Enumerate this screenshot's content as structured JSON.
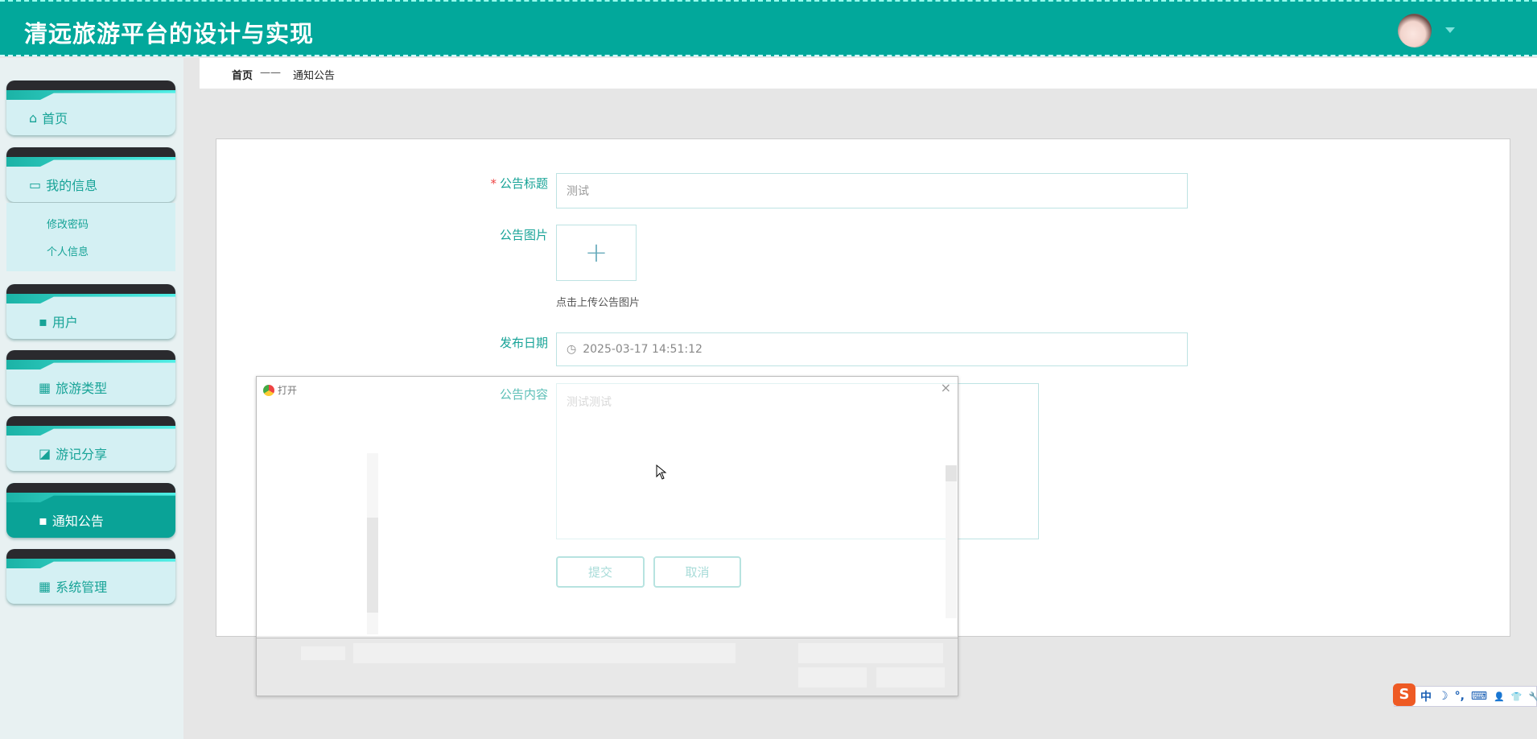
{
  "header": {
    "title": "清远旅游平台的设计与实现"
  },
  "sidebar": {
    "items": [
      {
        "label": "首页",
        "icon": "home-icon"
      },
      {
        "label": "我的信息",
        "icon": "wallet-icon",
        "children": [
          "修改密码",
          "个人信息"
        ]
      },
      {
        "label": "用户",
        "icon": "user-icon"
      },
      {
        "label": "旅游类型",
        "icon": "grid-icon"
      },
      {
        "label": "游记分享",
        "icon": "chart-icon"
      },
      {
        "label": "通知公告",
        "icon": "chat-icon",
        "active": true
      },
      {
        "label": "系统管理",
        "icon": "grid-icon"
      }
    ]
  },
  "breadcrumb": {
    "home": "首页",
    "sep": "——",
    "current": "通知公告"
  },
  "form": {
    "title_label": "公告标题",
    "title_value": "测试",
    "image_label": "公告图片",
    "image_hint": "点击上传公告图片",
    "date_label": "发布日期",
    "date_value": "2025-03-17 14:51:12",
    "content_label": "公告内容",
    "content_value": "测试测试",
    "submit": "提交",
    "cancel": "取消"
  },
  "dialog": {
    "title": "打开",
    "close": "×"
  },
  "ime": {
    "mode": "中",
    "items": [
      "☽",
      "°,",
      "⌨",
      "👤",
      "👕",
      "🔧"
    ]
  },
  "colors": {
    "primary": "#02a89b",
    "sidebar_text": "#17a397"
  }
}
